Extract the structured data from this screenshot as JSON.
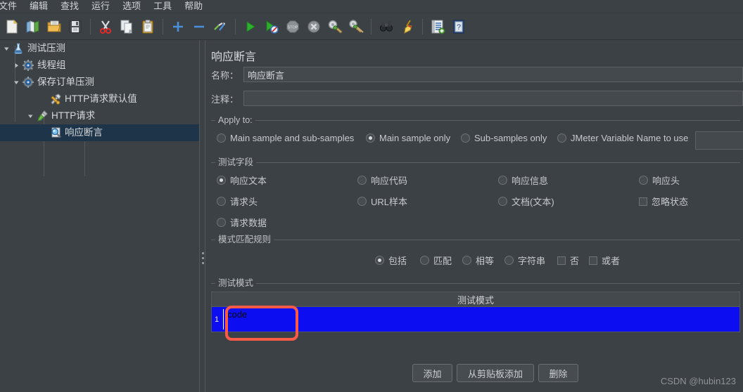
{
  "menu": {
    "items": [
      {
        "label": "文件"
      },
      {
        "label": "编辑"
      },
      {
        "label": "查找"
      },
      {
        "label": "运行"
      },
      {
        "label": "选项"
      },
      {
        "label": "工具"
      },
      {
        "label": "帮助"
      }
    ]
  },
  "toolbar": {
    "items": [
      {
        "icon": "new-file-icon"
      },
      {
        "icon": "open-templates-icon"
      },
      {
        "icon": "open-folder-icon"
      },
      {
        "icon": "save-icon"
      },
      {
        "sep": true
      },
      {
        "icon": "cut-scissors-icon"
      },
      {
        "icon": "copy-icon"
      },
      {
        "icon": "paste-clipboard-icon"
      },
      {
        "sep": true
      },
      {
        "icon": "expand-plus-icon"
      },
      {
        "icon": "collapse-minus-icon"
      },
      {
        "icon": "toggle-enable-icon"
      },
      {
        "sep": true
      },
      {
        "icon": "start-play-icon"
      },
      {
        "icon": "start-no-timers-icon"
      },
      {
        "icon": "stop-icon"
      },
      {
        "icon": "shutdown-icon"
      },
      {
        "icon": "clear-icon"
      },
      {
        "icon": "clear-all-icon"
      },
      {
        "sep": true
      },
      {
        "icon": "search-binoculars-icon"
      },
      {
        "icon": "reset-search-broom-icon"
      },
      {
        "sep": true
      },
      {
        "icon": "function-helper-icon"
      },
      {
        "icon": "help-book-icon"
      }
    ]
  },
  "tree": {
    "nodes": [
      {
        "label": "测试压测",
        "icon": "test-plan-icon",
        "depth": 0,
        "twist": "down",
        "selected": false
      },
      {
        "label": "线程组",
        "icon": "thread-group-icon",
        "depth": 1,
        "twist": "right",
        "selected": false
      },
      {
        "label": "保存订单压测",
        "icon": "thread-group-icon",
        "depth": 1,
        "twist": "down",
        "selected": false
      },
      {
        "label": "HTTP请求默认值",
        "icon": "http-defaults-icon",
        "depth": 2,
        "twist": "none",
        "selected": false
      },
      {
        "label": "HTTP请求",
        "icon": "http-request-icon",
        "depth": 2,
        "twist": "down",
        "selected": false
      },
      {
        "label": "响应断言",
        "icon": "response-assertion-icon",
        "depth": 3,
        "twist": "none",
        "selected": true
      }
    ]
  },
  "panel": {
    "title": "响应断言",
    "name_label": "名称：",
    "name_value": "响应断言",
    "comment_label": "注释：",
    "comment_value": "",
    "apply_to": {
      "title": "Apply to:",
      "options": [
        {
          "label": "Main sample and sub-samples",
          "checked": false
        },
        {
          "label": "Main sample only",
          "checked": true
        },
        {
          "label": "Sub-samples only",
          "checked": false
        },
        {
          "label": "JMeter Variable Name to use",
          "checked": false
        }
      ],
      "variable_value": ""
    },
    "test_field": {
      "title": "测试字段",
      "options": [
        {
          "label": "响应文本",
          "checked": true,
          "type": "radio",
          "col": 0,
          "row": 0
        },
        {
          "label": "响应代码",
          "checked": false,
          "type": "radio",
          "col": 1,
          "row": 0
        },
        {
          "label": "响应信息",
          "checked": false,
          "type": "radio",
          "col": 2,
          "row": 0
        },
        {
          "label": "响应头",
          "checked": false,
          "type": "radio",
          "col": 3,
          "row": 0
        },
        {
          "label": "请求头",
          "checked": false,
          "type": "radio",
          "col": 0,
          "row": 1
        },
        {
          "label": "URL样本",
          "checked": false,
          "type": "radio",
          "col": 1,
          "row": 1
        },
        {
          "label": "文档(文本)",
          "checked": false,
          "type": "radio",
          "col": 2,
          "row": 1
        },
        {
          "label": "忽略状态",
          "checked": false,
          "type": "checkbox",
          "col": 3,
          "row": 1
        },
        {
          "label": "请求数据",
          "checked": false,
          "type": "radio",
          "col": 0,
          "row": 2
        }
      ]
    },
    "pattern_rules": {
      "title": "模式匹配规则",
      "options": [
        {
          "label": "包括",
          "checked": true,
          "type": "radio"
        },
        {
          "label": "匹配",
          "checked": false,
          "type": "radio"
        },
        {
          "label": "相等",
          "checked": false,
          "type": "radio"
        },
        {
          "label": "字符串",
          "checked": false,
          "type": "radio"
        },
        {
          "label": "否",
          "checked": false,
          "type": "checkbox"
        },
        {
          "label": "或者",
          "checked": false,
          "type": "checkbox"
        }
      ]
    },
    "patterns": {
      "title": "测试模式",
      "column_header": "测试模式",
      "rows": [
        {
          "index": "1",
          "value": "code",
          "selected": true,
          "editing": true
        }
      ]
    },
    "buttons": [
      {
        "label": "添加"
      },
      {
        "label": "从剪贴板添加"
      },
      {
        "label": "删除"
      }
    ]
  },
  "watermark": "CSDN @hubin123",
  "colors": {
    "window_bg": "#3c4145",
    "selection_blue": "#0d0df2",
    "tree_selection": "#1e3448",
    "annotation_red": "#fa5a46"
  }
}
